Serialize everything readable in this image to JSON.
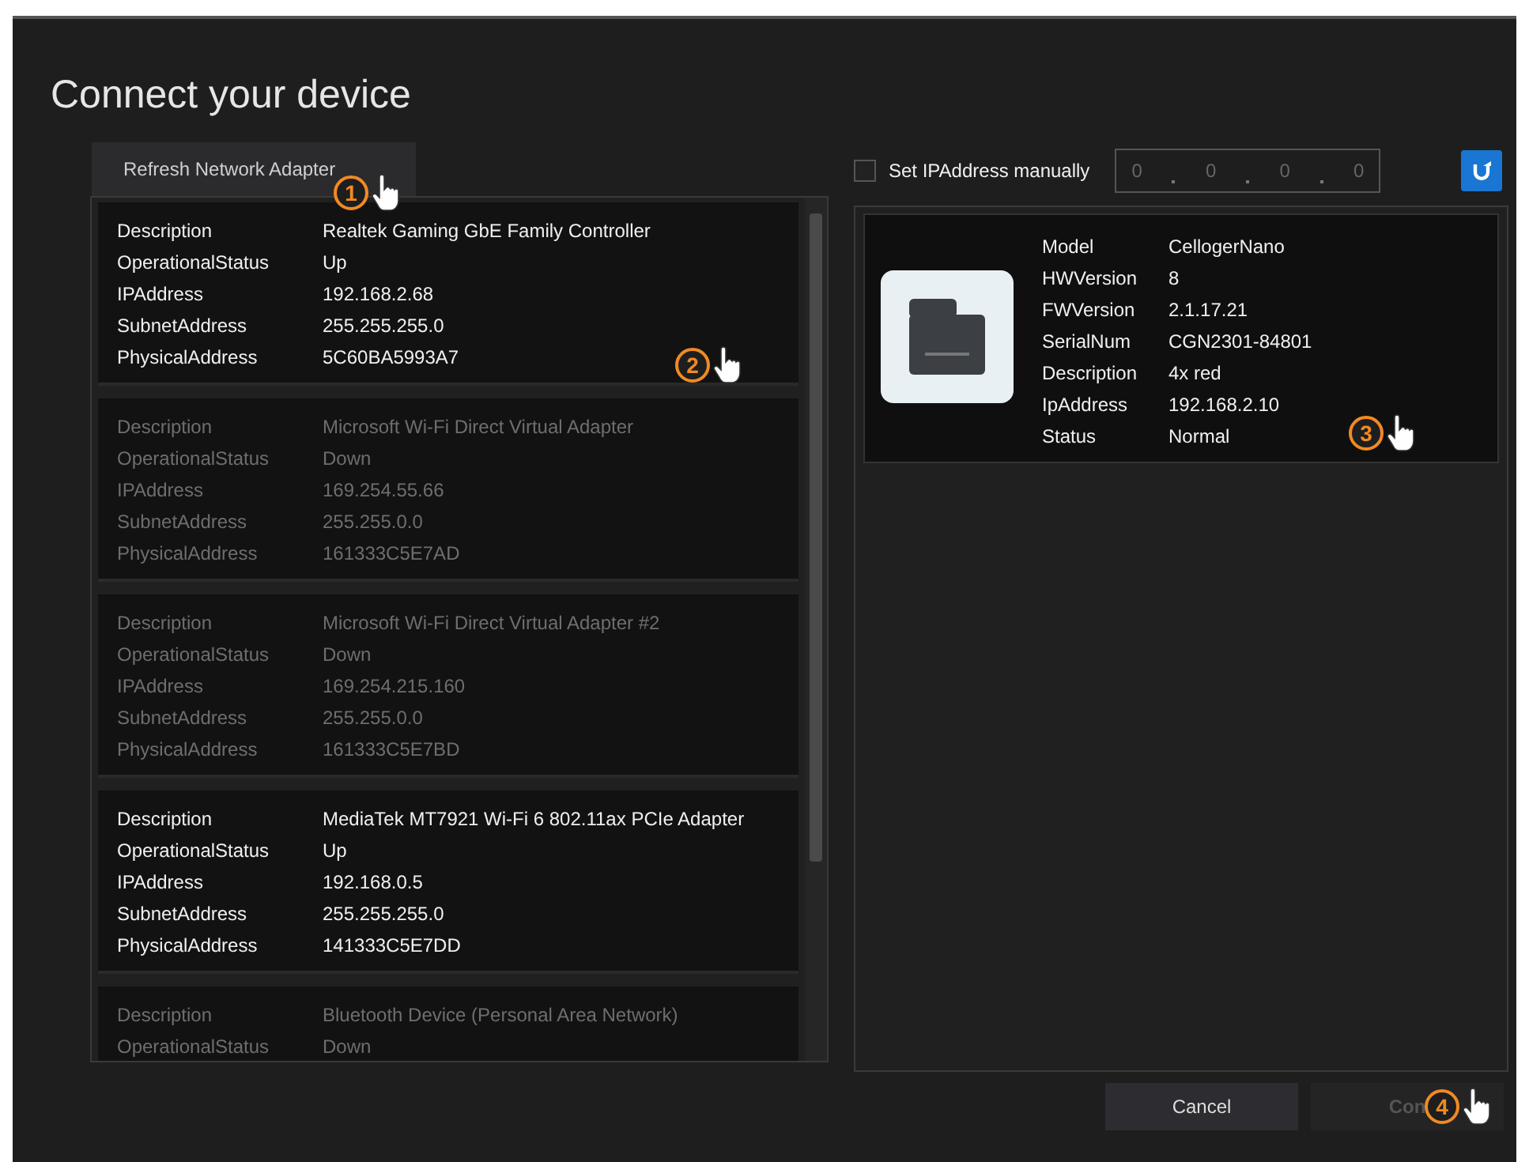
{
  "dialog": {
    "title": "Connect your device"
  },
  "refresh_adapter_button": {
    "label": "Refresh Network Adapter"
  },
  "adapters": [
    {
      "active": true,
      "fields": [
        {
          "label": "Description",
          "value": "Realtek Gaming GbE Family Controller"
        },
        {
          "label": "OperationalStatus",
          "value": "Up"
        },
        {
          "label": "IPAddress",
          "value": "192.168.2.68"
        },
        {
          "label": "SubnetAddress",
          "value": "255.255.255.0"
        },
        {
          "label": "PhysicalAddress",
          "value": "5C60BA5993A7"
        }
      ]
    },
    {
      "active": false,
      "fields": [
        {
          "label": "Description",
          "value": "Microsoft Wi-Fi Direct Virtual Adapter"
        },
        {
          "label": "OperationalStatus",
          "value": "Down"
        },
        {
          "label": "IPAddress",
          "value": "169.254.55.66"
        },
        {
          "label": "SubnetAddress",
          "value": "255.255.0.0"
        },
        {
          "label": "PhysicalAddress",
          "value": "161333C5E7AD"
        }
      ]
    },
    {
      "active": false,
      "fields": [
        {
          "label": "Description",
          "value": "Microsoft Wi-Fi Direct Virtual Adapter #2"
        },
        {
          "label": "OperationalStatus",
          "value": "Down"
        },
        {
          "label": "IPAddress",
          "value": "169.254.215.160"
        },
        {
          "label": "SubnetAddress",
          "value": "255.255.0.0"
        },
        {
          "label": "PhysicalAddress",
          "value": "161333C5E7BD"
        }
      ]
    },
    {
      "active": true,
      "fields": [
        {
          "label": "Description",
          "value": "MediaTek MT7921 Wi-Fi 6 802.11ax PCIe Adapter"
        },
        {
          "label": "OperationalStatus",
          "value": "Up"
        },
        {
          "label": "IPAddress",
          "value": "192.168.0.5"
        },
        {
          "label": "SubnetAddress",
          "value": "255.255.255.0"
        },
        {
          "label": "PhysicalAddress",
          "value": "141333C5E7DD"
        }
      ]
    },
    {
      "active": false,
      "fields": [
        {
          "label": "Description",
          "value": "Bluetooth Device (Personal Area Network)"
        },
        {
          "label": "OperationalStatus",
          "value": "Down"
        }
      ]
    }
  ],
  "manual_ip": {
    "label": "Set IPAddress manually",
    "checked": false,
    "segments": [
      "0",
      "0",
      "0",
      "0"
    ]
  },
  "devices": [
    {
      "selected": true,
      "fields": [
        {
          "label": "Model",
          "value": "CellogerNano"
        },
        {
          "label": "HWVersion",
          "value": "8"
        },
        {
          "label": "FWVersion",
          "value": "2.1.17.21"
        },
        {
          "label": "SerialNum",
          "value": "CGN2301-84801"
        },
        {
          "label": "Description",
          "value": "4x red"
        },
        {
          "label": "IpAddress",
          "value": "192.168.2.10"
        },
        {
          "label": "Status",
          "value": "Normal"
        }
      ]
    }
  ],
  "buttons": [
    {
      "kind": "secondary",
      "label": "Cancel",
      "disabled": false
    },
    {
      "kind": "primary",
      "label": "Con",
      "disabled": true
    }
  ],
  "callouts": [
    "1",
    "2",
    "3",
    "4"
  ]
}
